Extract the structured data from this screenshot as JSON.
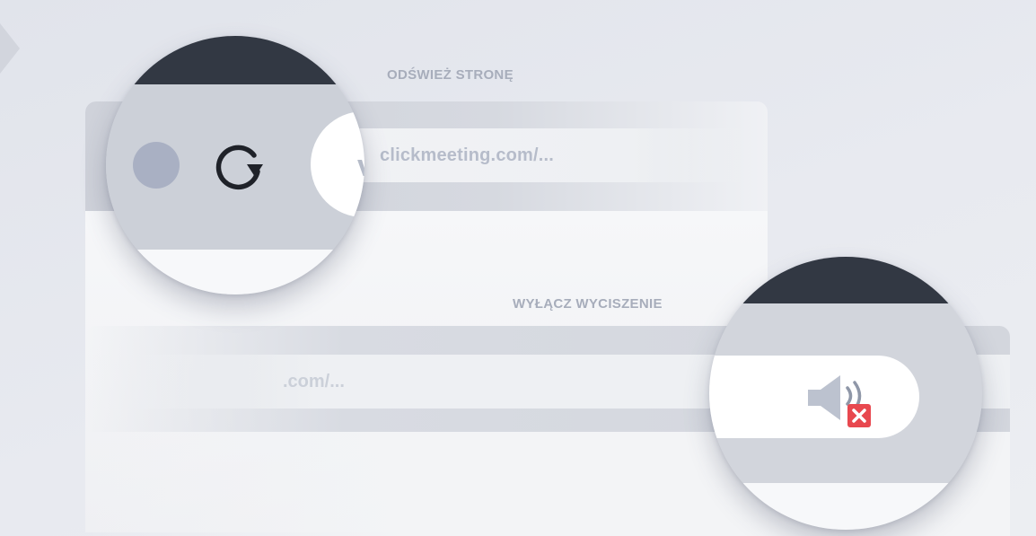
{
  "captions": {
    "refresh": "ODŚWIEŻ STRONĘ",
    "unmute": "WYŁĄCZ WYCISZENIE"
  },
  "browser_top": {
    "url": "clickmeeting.com/...",
    "url_initial": "v"
  },
  "browser_bottom": {
    "url": ".com/..."
  },
  "icons": {
    "reload": "reload-icon",
    "speaker_muted": "speaker-muted-icon",
    "mute_badge": "close-icon"
  },
  "colors": {
    "background": "#e4e7ee",
    "caption": "#a7adbb",
    "lens_dark": "#323843",
    "dot": "#a9b0c3",
    "mute_badge": "#e8484f"
  }
}
